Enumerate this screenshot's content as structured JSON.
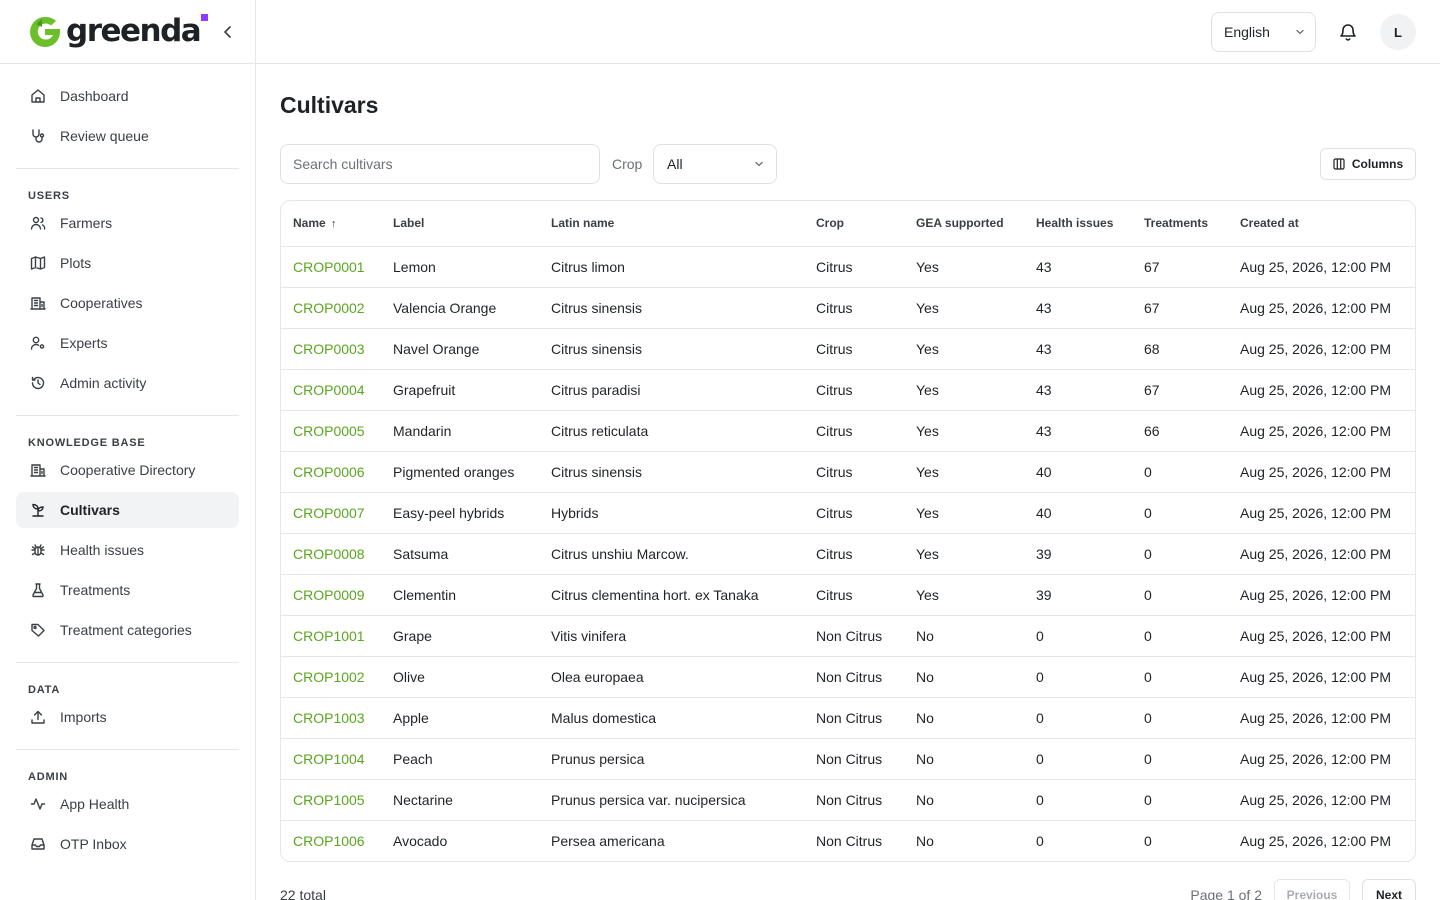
{
  "brand": {
    "name": "greenda",
    "accent": "#5aa61f",
    "dot_color": "#8b3dff"
  },
  "topbar": {
    "language": "English",
    "avatar_initial": "L"
  },
  "sidebar": {
    "groups": [
      {
        "label": "",
        "items": [
          {
            "label": "Dashboard",
            "icon": "home-icon"
          },
          {
            "label": "Review queue",
            "icon": "stethoscope-icon"
          }
        ]
      },
      {
        "label": "USERS",
        "items": [
          {
            "label": "Farmers",
            "icon": "users-icon"
          },
          {
            "label": "Plots",
            "icon": "map-icon"
          },
          {
            "label": "Cooperatives",
            "icon": "building-icon"
          },
          {
            "label": "Experts",
            "icon": "user-cog-icon"
          },
          {
            "label": "Admin activity",
            "icon": "history-icon"
          }
        ]
      },
      {
        "label": "KNOWLEDGE BASE",
        "items": [
          {
            "label": "Cooperative Directory",
            "icon": "building-icon"
          },
          {
            "label": "Cultivars",
            "icon": "sprout-icon",
            "active": true
          },
          {
            "label": "Health issues",
            "icon": "bug-icon"
          },
          {
            "label": "Treatments",
            "icon": "flask-icon"
          },
          {
            "label": "Treatment categories",
            "icon": "tag-icon"
          }
        ]
      },
      {
        "label": "DATA",
        "items": [
          {
            "label": "Imports",
            "icon": "upload-icon"
          }
        ]
      },
      {
        "label": "ADMIN",
        "items": [
          {
            "label": "App Health",
            "icon": "activity-icon"
          },
          {
            "label": "OTP Inbox",
            "icon": "inbox-icon"
          }
        ]
      }
    ]
  },
  "page": {
    "title": "Cultivars",
    "search_placeholder": "Search cultivars",
    "crop_label": "Crop",
    "crop_value": "All",
    "columns_label": "Columns"
  },
  "table": {
    "headers": [
      "Name",
      "Label",
      "Latin name",
      "Crop",
      "GEA supported",
      "Health issues",
      "Treatments",
      "Created at"
    ],
    "sort_indicator": "↑",
    "rows": [
      [
        "CROP0001",
        "Lemon",
        "Citrus limon",
        "Citrus",
        "Yes",
        "43",
        "67",
        "Aug 25, 2026, 12:00 PM"
      ],
      [
        "CROP0002",
        "Valencia Orange",
        "Citrus sinensis",
        "Citrus",
        "Yes",
        "43",
        "67",
        "Aug 25, 2026, 12:00 PM"
      ],
      [
        "CROP0003",
        "Navel Orange",
        "Citrus sinensis",
        "Citrus",
        "Yes",
        "43",
        "68",
        "Aug 25, 2026, 12:00 PM"
      ],
      [
        "CROP0004",
        "Grapefruit",
        "Citrus paradisi",
        "Citrus",
        "Yes",
        "43",
        "67",
        "Aug 25, 2026, 12:00 PM"
      ],
      [
        "CROP0005",
        "Mandarin",
        "Citrus reticulata",
        "Citrus",
        "Yes",
        "43",
        "66",
        "Aug 25, 2026, 12:00 PM"
      ],
      [
        "CROP0006",
        "Pigmented oranges",
        "Citrus sinensis",
        "Citrus",
        "Yes",
        "40",
        "0",
        "Aug 25, 2026, 12:00 PM"
      ],
      [
        "CROP0007",
        "Easy-peel hybrids",
        "Hybrids",
        "Citrus",
        "Yes",
        "40",
        "0",
        "Aug 25, 2026, 12:00 PM"
      ],
      [
        "CROP0008",
        "Satsuma",
        "Citrus unshiu Marcow.",
        "Citrus",
        "Yes",
        "39",
        "0",
        "Aug 25, 2026, 12:00 PM"
      ],
      [
        "CROP0009",
        "Clementin",
        "Citrus clementina hort. ex Tanaka",
        "Citrus",
        "Yes",
        "39",
        "0",
        "Aug 25, 2026, 12:00 PM"
      ],
      [
        "CROP1001",
        "Grape",
        "Vitis vinifera",
        "Non Citrus",
        "No",
        "0",
        "0",
        "Aug 25, 2026, 12:00 PM"
      ],
      [
        "CROP1002",
        "Olive",
        "Olea europaea",
        "Non Citrus",
        "No",
        "0",
        "0",
        "Aug 25, 2026, 12:00 PM"
      ],
      [
        "CROP1003",
        "Apple",
        "Malus domestica",
        "Non Citrus",
        "No",
        "0",
        "0",
        "Aug 25, 2026, 12:00 PM"
      ],
      [
        "CROP1004",
        "Peach",
        "Prunus persica",
        "Non Citrus",
        "No",
        "0",
        "0",
        "Aug 25, 2026, 12:00 PM"
      ],
      [
        "CROP1005",
        "Nectarine",
        "Prunus persica var. nucipersica",
        "Non Citrus",
        "No",
        "0",
        "0",
        "Aug 25, 2026, 12:00 PM"
      ],
      [
        "CROP1006",
        "Avocado",
        "Persea americana",
        "Non Citrus",
        "No",
        "0",
        "0",
        "Aug 25, 2026, 12:00 PM"
      ]
    ]
  },
  "footer": {
    "total": "22 total",
    "page_info": "Page 1 of 2",
    "previous": "Previous",
    "next": "Next"
  }
}
